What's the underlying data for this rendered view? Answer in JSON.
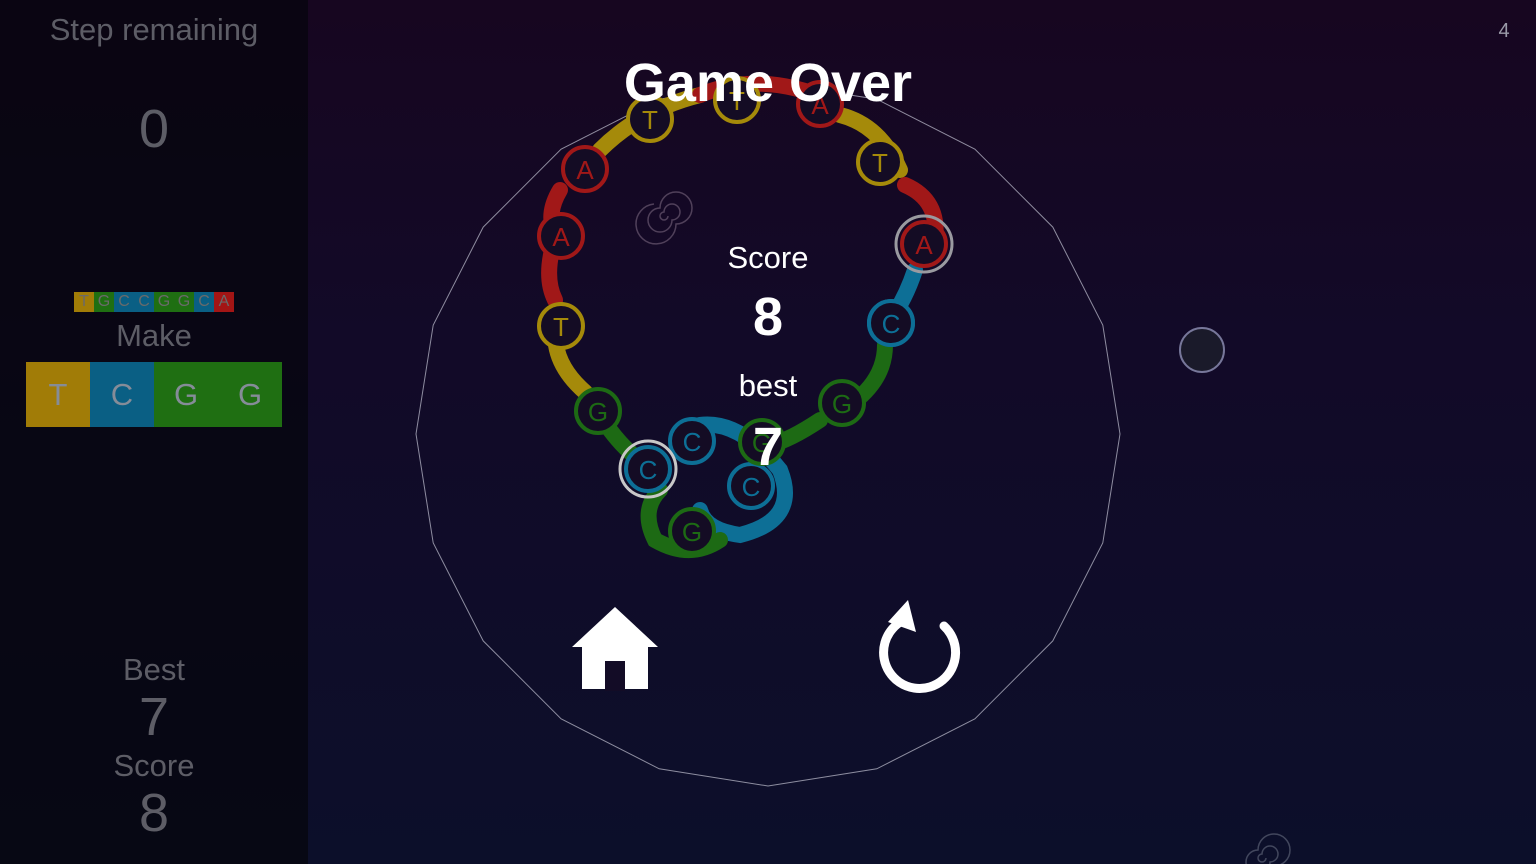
{
  "sidebar": {
    "step_label": "Step remaining",
    "step_value": "0",
    "target_strip": [
      {
        "letter": "T",
        "color": "#a17c07"
      },
      {
        "letter": "G",
        "color": "#1f6f12"
      },
      {
        "letter": "C",
        "color": "#0a5f84"
      },
      {
        "letter": "C",
        "color": "#0a5f84"
      },
      {
        "letter": "G",
        "color": "#1f6f12"
      },
      {
        "letter": "G",
        "color": "#1f6f12"
      },
      {
        "letter": "C",
        "color": "#0a5f84"
      },
      {
        "letter": "A",
        "color": "#a31515"
      }
    ],
    "make_label": "Make",
    "make_tiles": [
      {
        "letter": "T",
        "color": "#a17c07"
      },
      {
        "letter": "C",
        "color": "#0a5f84"
      },
      {
        "letter": "G",
        "color": "#1f6f12"
      },
      {
        "letter": "G",
        "color": "#1f6f12"
      }
    ],
    "best_label": "Best",
    "best_value": "7",
    "score_label": "Score",
    "score_value": "8"
  },
  "corner_number": "4",
  "dialog": {
    "title": "Game Over",
    "score_label": "Score",
    "score_value": "8",
    "best_label": "best",
    "best_value": "7",
    "home_icon": "home-icon",
    "restart_icon": "restart-icon"
  },
  "ring_nodes": [
    {
      "letter": "T",
      "color": "#a58a0a"
    },
    {
      "letter": "T",
      "color": "#a58a0a"
    },
    {
      "letter": "A",
      "color": "#a11818"
    },
    {
      "letter": "T",
      "color": "#a58a0a"
    },
    {
      "letter": "A",
      "color": "#a11818"
    },
    {
      "letter": "C",
      "color": "#0d6f96"
    },
    {
      "letter": "G",
      "color": "#1d6a14"
    },
    {
      "letter": "C",
      "color": "#0d6f96"
    },
    {
      "letter": "C",
      "color": "#0d6f96"
    },
    {
      "letter": "G",
      "color": "#1d6a14"
    },
    {
      "letter": "G",
      "color": "#1d6a14"
    },
    {
      "letter": "T",
      "color": "#a58a0a"
    },
    {
      "letter": "A",
      "color": "#a11818"
    },
    {
      "letter": "A",
      "color": "#a11818"
    },
    {
      "letter": "C",
      "color": "#0d6f96"
    },
    {
      "letter": "G",
      "color": "#1d6a14"
    },
    {
      "letter": "C",
      "color": "#0d6f96"
    }
  ],
  "colors": {
    "yellow": "#a58a0a",
    "red": "#a11818",
    "blue": "#0d6f96",
    "green": "#1d6a14"
  }
}
